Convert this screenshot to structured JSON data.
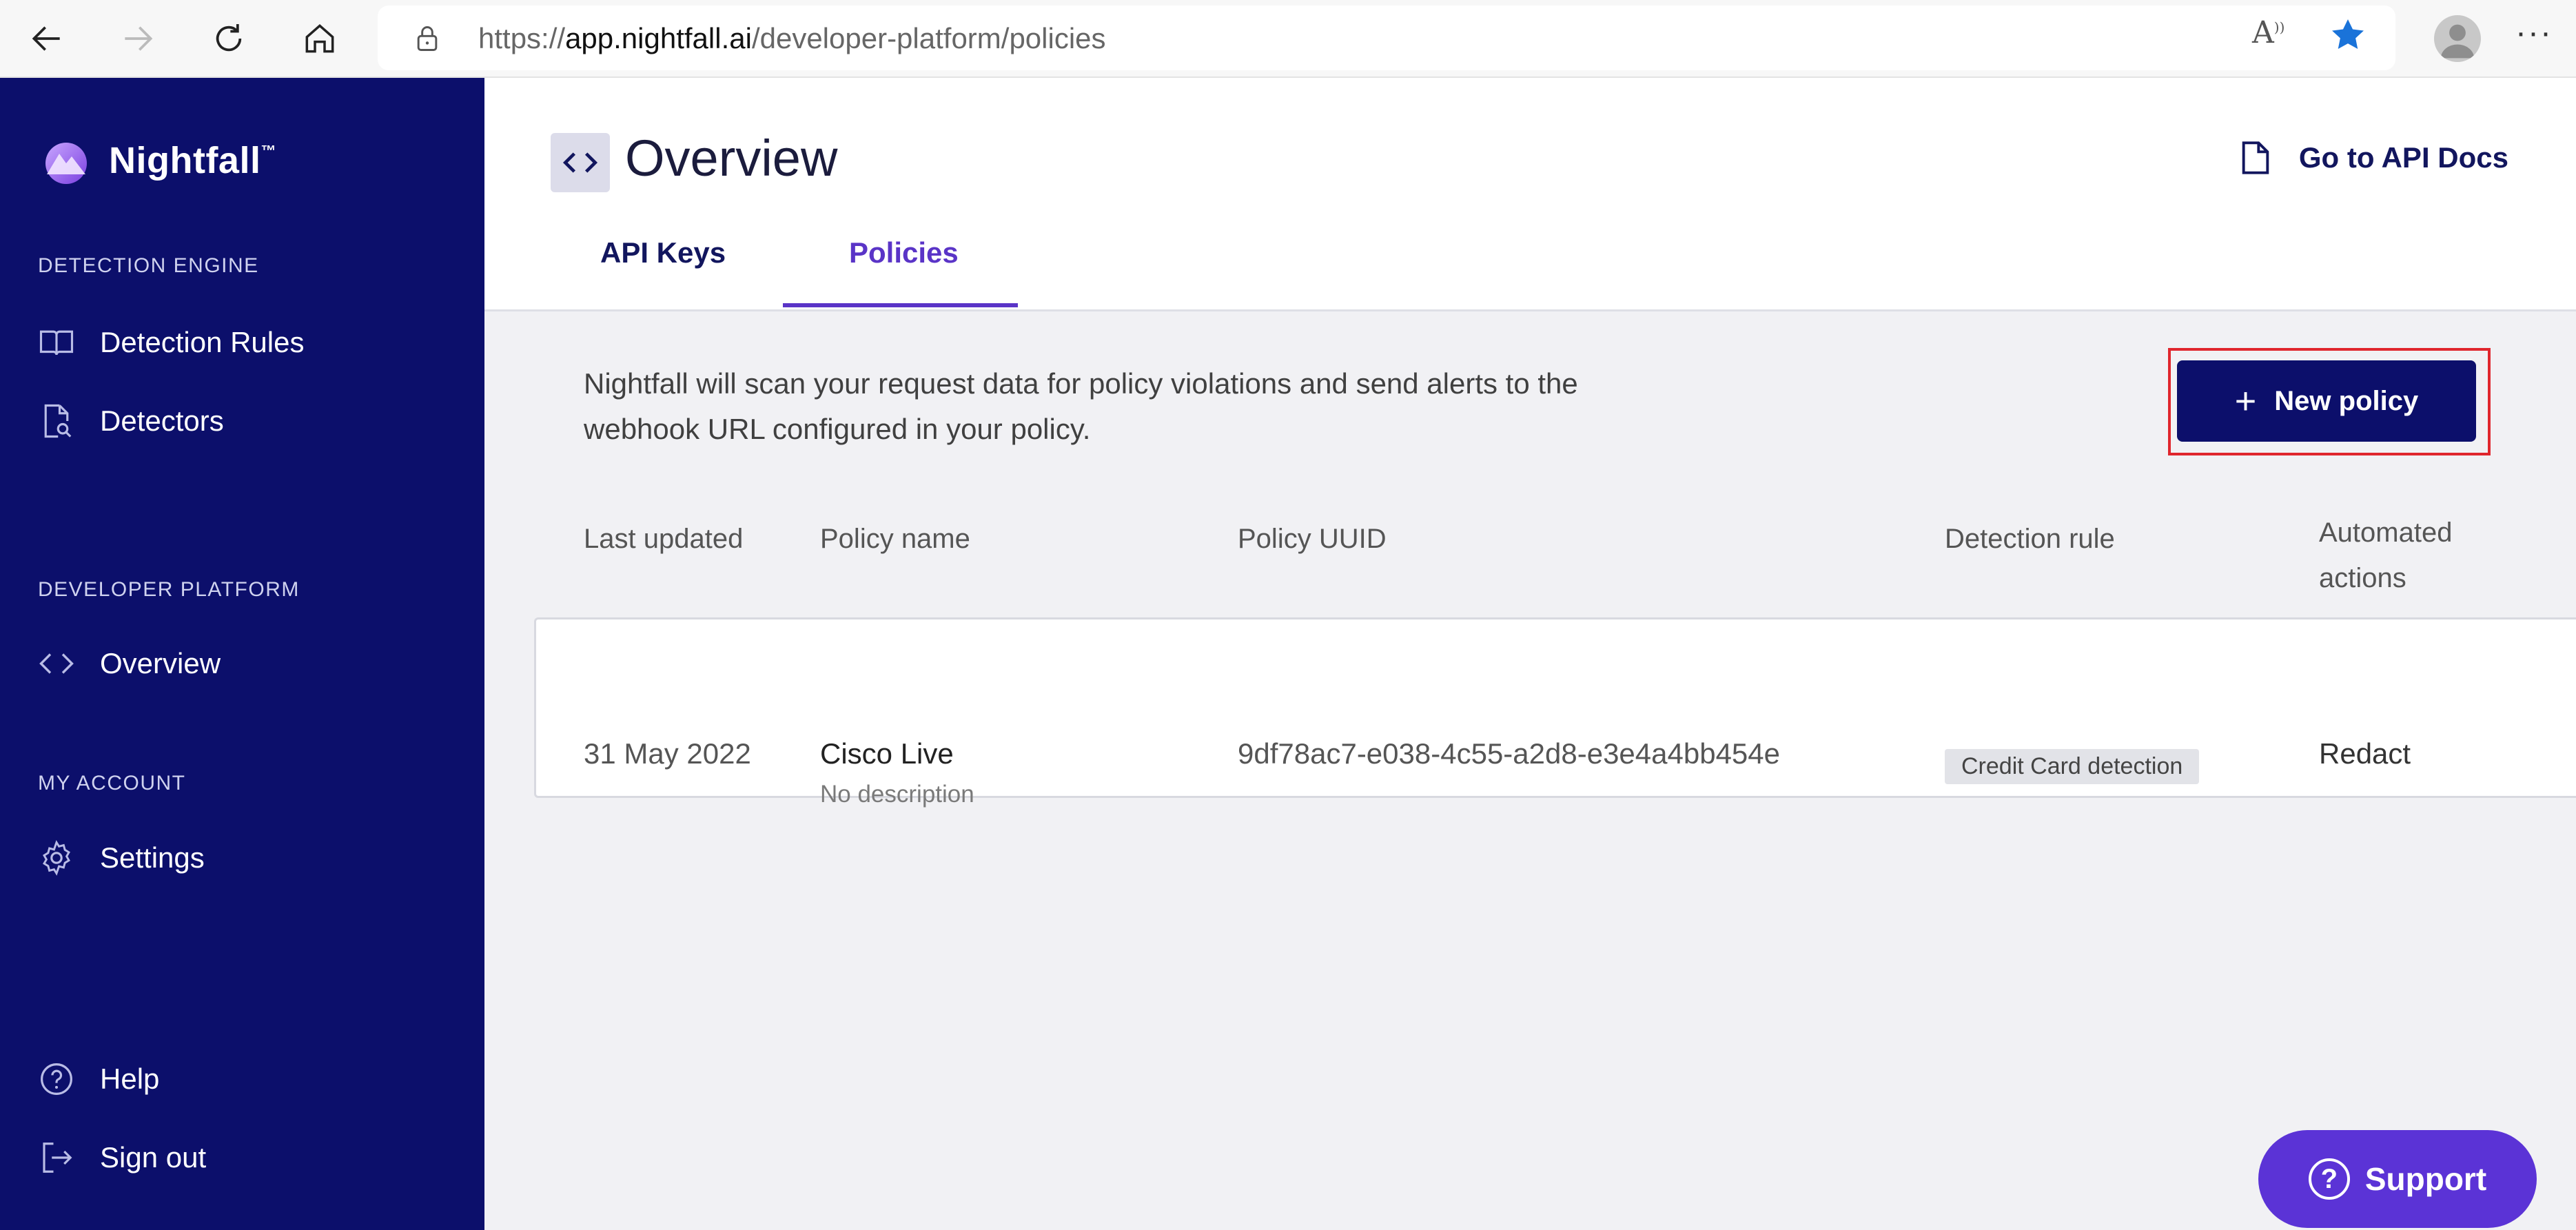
{
  "browser": {
    "url_scheme": "https://",
    "url_host": "app.nightfall.ai",
    "url_path": "/developer-platform/policies",
    "read_aloud_label": "A",
    "more_label": "···"
  },
  "sidebar": {
    "brand": "Nightfall",
    "brand_tm": "™",
    "sections": [
      {
        "title": "DETECTION ENGINE",
        "items": [
          {
            "label": "Detection Rules",
            "icon": "book-icon"
          },
          {
            "label": "Detectors",
            "icon": "file-search-icon"
          }
        ]
      },
      {
        "title": "DEVELOPER PLATFORM",
        "items": [
          {
            "label": "Overview",
            "icon": "code-icon"
          }
        ]
      },
      {
        "title": "MY ACCOUNT",
        "items": [
          {
            "label": "Settings",
            "icon": "gear-icon"
          }
        ]
      }
    ],
    "footer": [
      {
        "label": "Help",
        "icon": "help-icon"
      },
      {
        "label": "Sign out",
        "icon": "sign-out-icon"
      }
    ]
  },
  "header": {
    "title": "Overview",
    "api_docs_label": "Go to API Docs",
    "tabs": [
      {
        "label": "API Keys",
        "active": false
      },
      {
        "label": "Policies",
        "active": true
      }
    ]
  },
  "policies": {
    "description": "Nightfall will scan your request data for policy violations and send alerts to the webhook URL configured in your policy.",
    "new_button": "New policy",
    "columns": [
      "Last updated",
      "Policy name",
      "Policy UUID",
      "Detection rule",
      "Automated actions"
    ],
    "rows": [
      {
        "last_updated": "31 May 2022",
        "name": "Cisco Live",
        "description": "No description",
        "uuid": "9df78ac7-e038-4c55-a2d8-e3e4a4bb454e",
        "detection_rule": "Credit Card detection",
        "actions": "Redact"
      }
    ]
  },
  "support_label": "Support",
  "colors": {
    "sidebar": "#0c0f6b",
    "accent": "#5a34c7",
    "highlight": "#e0262d",
    "support": "#5b33d6"
  }
}
